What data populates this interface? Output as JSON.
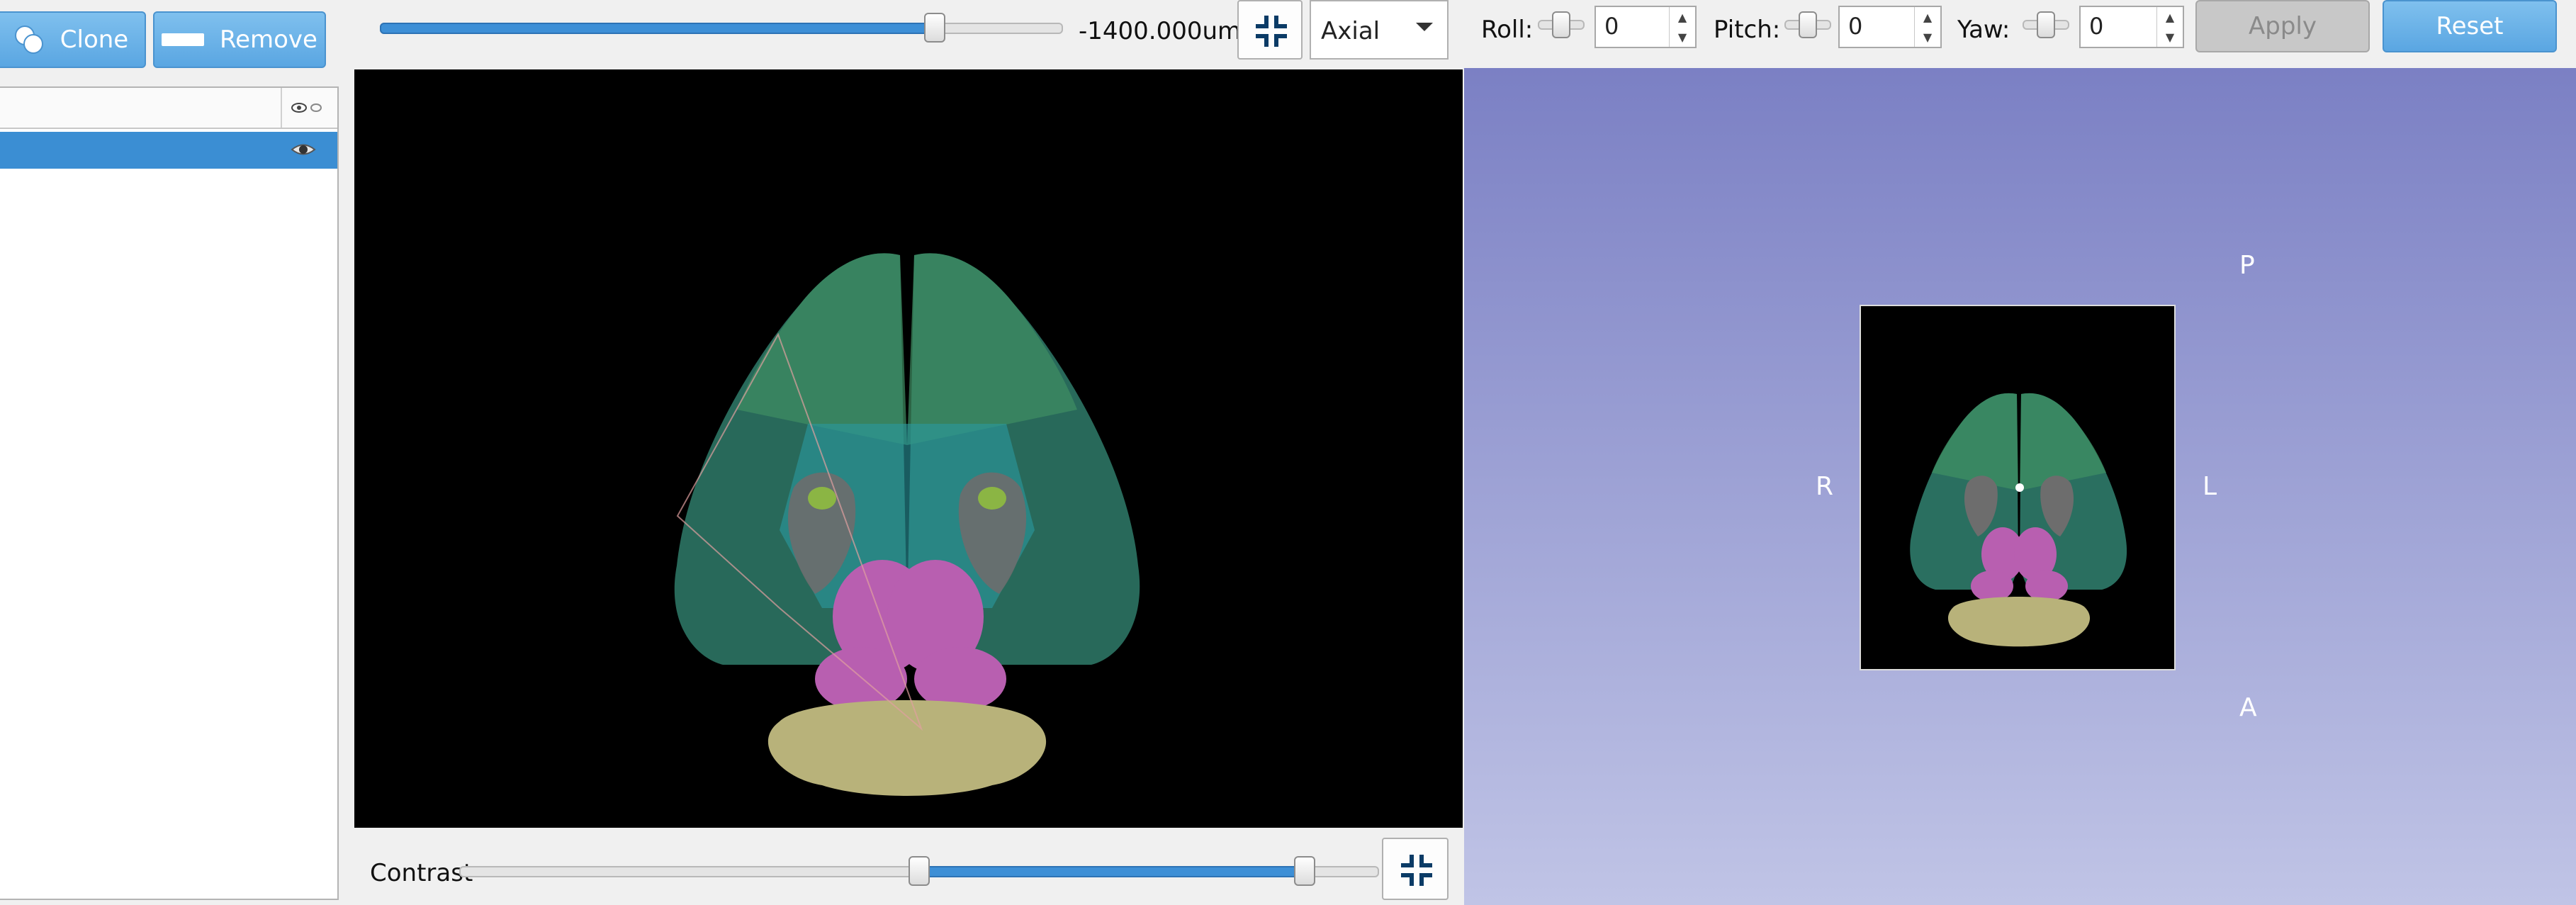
{
  "left_panel": {
    "clone_label": "Clone",
    "remove_label": "Remove"
  },
  "slice_toolbar": {
    "position_value": 0.77,
    "position_label": "-1400.000um",
    "orientation_selected": "Axial"
  },
  "rotation_toolbar": {
    "roll_label": "Roll:",
    "roll_value": "0",
    "pitch_label": "Pitch:",
    "pitch_value": "0",
    "yaw_label": "Yaw:",
    "yaw_value": "0",
    "apply_label": "Apply",
    "reset_label": "Reset"
  },
  "contrast": {
    "label": "Contrast",
    "range_low": 0.5,
    "range_high": 0.92
  },
  "view_3d": {
    "orient_top": "P",
    "orient_bottom": "A",
    "orient_left": "R",
    "orient_right": "L"
  },
  "colors": {
    "accent": "#3d8fd6",
    "row_selected": "#3b8ed3",
    "gradient_top": "#7b80c4",
    "gradient_bottom": "#c0c4e6"
  },
  "icons": [
    "clone-icon",
    "remove-icon",
    "eye-icon",
    "visibility-header-icon",
    "fit-view-icon",
    "dropdown-arrow-icon",
    "spin-up-icon",
    "spin-down-icon"
  ]
}
